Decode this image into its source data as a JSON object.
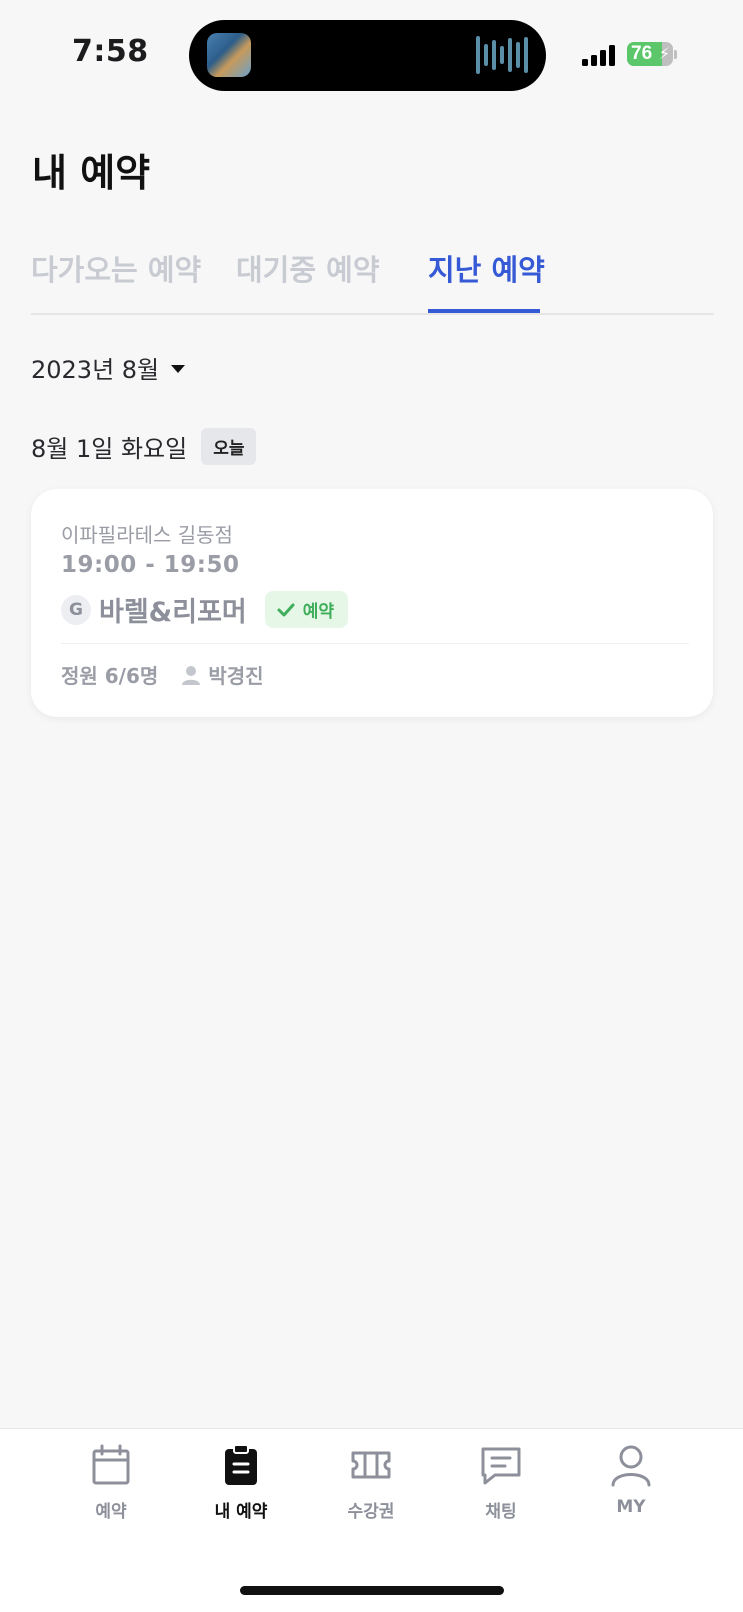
{
  "status_bar": {
    "time": "7:58",
    "battery": "76",
    "battery_level": 0.76
  },
  "page": {
    "title": "내 예약"
  },
  "tabs": [
    {
      "label": "다가오는 예약",
      "active": false
    },
    {
      "label": "대기중 예약",
      "active": false
    },
    {
      "label": "지난 예약",
      "active": true
    }
  ],
  "month": {
    "label": "2023년 8월"
  },
  "date_group": {
    "date": "8월 1일 화요일",
    "badge": "오늘"
  },
  "reservation": {
    "studio": "이파필라테스 길동점",
    "time": "19:00 - 19:50",
    "grade": "G",
    "class_name": "바렐&리포머",
    "status": "예약",
    "capacity": "정원 6/6명",
    "instructor": "박경진"
  },
  "bottom_nav": [
    {
      "label": "예약",
      "icon": "calendar-icon",
      "active": false
    },
    {
      "label": "내 예약",
      "icon": "clipboard-icon",
      "active": true
    },
    {
      "label": "수강권",
      "icon": "ticket-icon",
      "active": false
    },
    {
      "label": "채팅",
      "icon": "chat-icon",
      "active": false
    },
    {
      "label": "MY",
      "icon": "user-icon",
      "active": false
    }
  ],
  "colors": {
    "accent": "#3659d6",
    "success": "#3fae5a",
    "muted": "#9a9ca6"
  }
}
